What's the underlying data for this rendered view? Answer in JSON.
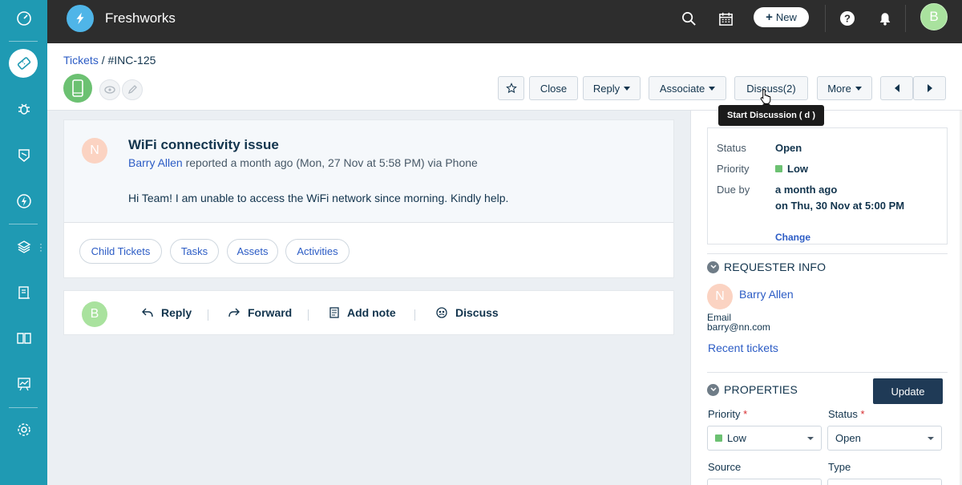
{
  "app": {
    "brand": "Freshworks"
  },
  "colors": {
    "rail": "#1f9ab3",
    "topbar": "#2d2d2d",
    "link": "#2c5cc5",
    "priority_low": "#6cc172",
    "update_button": "#1f3a56"
  },
  "rail": {
    "items": [
      "dashboard-icon",
      "tickets-icon",
      "problems-icon",
      "changes-icon",
      "releases-icon",
      "assets-icon",
      "contracts-icon",
      "solutions-icon",
      "reports-icon",
      "settings-icon"
    ]
  },
  "topbar": {
    "new_label": "New",
    "avatar_initial": "B"
  },
  "breadcrumb": {
    "tickets": "Tickets",
    "separator": "/",
    "ticket_id": "#INC-125"
  },
  "actions": {
    "close": "Close",
    "reply": "Reply",
    "associate": "Associate",
    "discuss": "Discuss(2)",
    "more": "More"
  },
  "tooltip": "Start Discussion ( d )",
  "ticket": {
    "avatar_initial": "N",
    "subject": "WiFi connectivity issue",
    "requester": "Barry Allen",
    "meta": "reported a month ago (Mon, 27 Nov at 5:58 PM) via Phone",
    "body": "Hi Team! I am unable to access the WiFi network since morning. Kindly help.",
    "tabs": [
      "Child Tickets",
      "Tasks",
      "Assets",
      "Activities"
    ]
  },
  "reply_bar": {
    "avatar_initial": "B",
    "reply": "Reply",
    "forward": "Forward",
    "add_note": "Add note",
    "discuss": "Discuss"
  },
  "status_box": {
    "status_label": "Status",
    "status_value": "Open",
    "priority_label": "Priority",
    "priority_value": "Low",
    "due_label": "Due by",
    "due_line1": "a month ago",
    "due_line2": "on Thu, 30 Nov at 5:00 PM",
    "change": "Change"
  },
  "requester_info": {
    "title": "REQUESTER INFO",
    "avatar_initial": "N",
    "name": "Barry Allen",
    "email_label": "Email",
    "email": "barry@nn.com",
    "recent": "Recent tickets"
  },
  "properties": {
    "title": "PROPERTIES",
    "update": "Update",
    "priority_label": "Priority",
    "priority_value": "Low",
    "status_label": "Status",
    "status_value": "Open",
    "source_label": "Source",
    "type_label": "Type",
    "required_mark": "*"
  }
}
